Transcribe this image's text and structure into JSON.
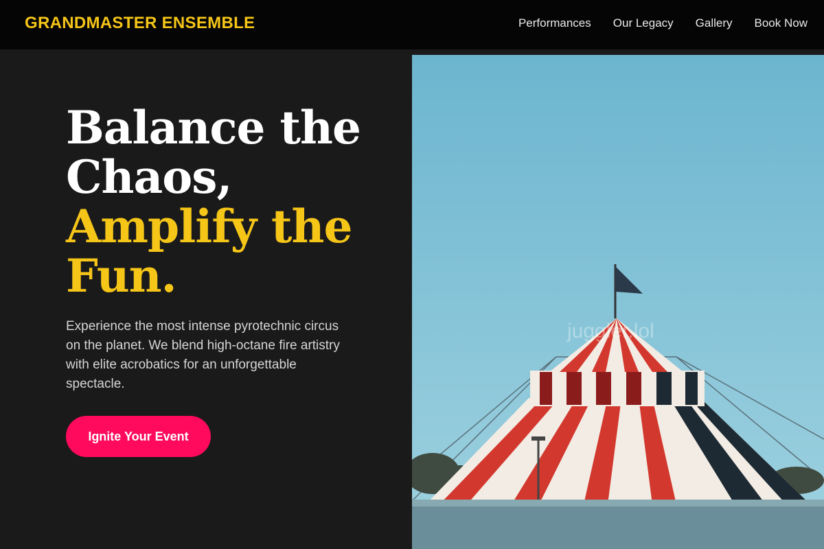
{
  "header": {
    "brand": "GRANDMASTER ENSEMBLE",
    "nav": [
      "Performances",
      "Our Legacy",
      "Gallery",
      "Book Now"
    ]
  },
  "hero": {
    "headline_line1": "Balance the",
    "headline_line2": "Chaos,",
    "headline_accent1": "Amplify the",
    "headline_accent2": "Fun.",
    "description": "Experience the most intense pyrotechnic circus on the planet. We blend high-octane fire artistry with elite acrobatics for an unforgettable spectacle.",
    "cta_label": "Ignite Your Event",
    "image_watermark": "juggler.lol"
  },
  "colors": {
    "accent": "#f5c518",
    "cta": "#ff0a5c",
    "background": "#1a1a1a",
    "header": "#050505"
  }
}
